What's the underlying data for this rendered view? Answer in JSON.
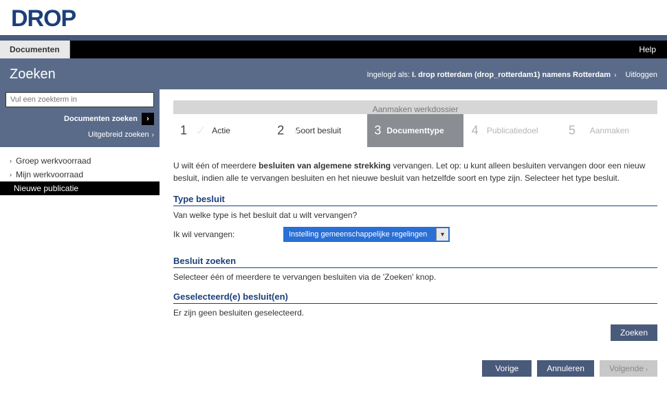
{
  "app": {
    "name": "DROP"
  },
  "menubar": {
    "documents": "Documenten",
    "help": "Help"
  },
  "subheader": {
    "title": "Zoeken",
    "loggedin_prefix": "Ingelogd als:",
    "loggedin_user": "I. drop rotterdam (drop_rotterdam1) namens Rotterdam",
    "logout": "Uitloggen"
  },
  "search": {
    "placeholder": "Vul een zoekterm in",
    "submit": "Documenten zoeken",
    "advanced": "Uitgebreid zoeken"
  },
  "nav": {
    "items": [
      {
        "label": "Groep werkvoorraad"
      },
      {
        "label": "Mijn werkvoorraad"
      },
      {
        "label": "Nieuwe publicatie"
      }
    ]
  },
  "stepper": {
    "title": "Aanmaken werkdossier",
    "steps": [
      {
        "num": "1",
        "label": "Actie"
      },
      {
        "num": "2",
        "label": "Soort besluit"
      },
      {
        "num": "3",
        "label": "Documenttype"
      },
      {
        "num": "4",
        "label": "Publicatiedoel"
      },
      {
        "num": "5",
        "label": "Aanmaken"
      }
    ]
  },
  "intro": {
    "text_before": "U wilt één of meerdere ",
    "text_bold": "besluiten van algemene strekking",
    "text_after": " vervangen. Let op: u kunt alleen besluiten vervangen door een nieuw besluit, indien alle te vervangen besluiten en het nieuwe besluit van hetzelfde soort en type zijn. Selecteer het type besluit."
  },
  "type_section": {
    "heading": "Type besluit",
    "sub": "Van welke type is het besluit dat u wilt vervangen?",
    "label": "Ik wil vervangen:",
    "selected": "Instelling gemeenschappelijke regelingen"
  },
  "zoeken_section": {
    "heading": "Besluit zoeken",
    "sub": "Selecteer één of meerdere te vervangen besluiten via de 'Zoeken' knop."
  },
  "selected_section": {
    "heading": "Geselecteerd(e) besluit(en)",
    "sub": "Er zijn geen besluiten geselecteerd."
  },
  "buttons": {
    "zoeken": "Zoeken",
    "vorige": "Vorige",
    "annuleren": "Annuleren",
    "volgende": "Volgende"
  }
}
